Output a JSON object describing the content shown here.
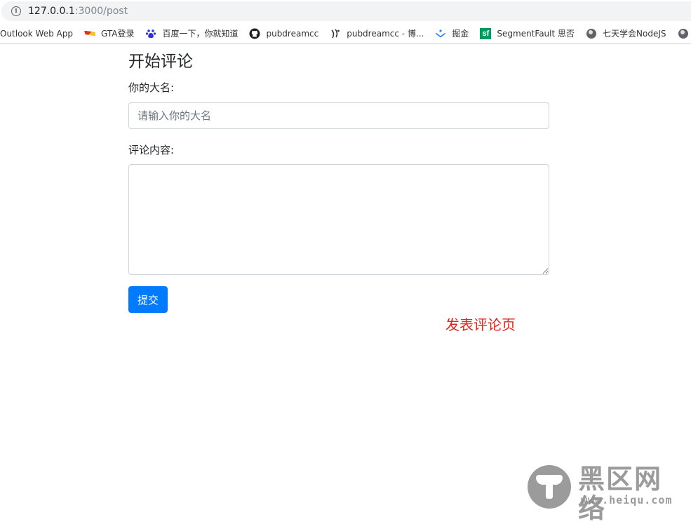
{
  "browser": {
    "url_host": "127.0.0.1",
    "url_path": ":3000/post",
    "bookmarks": [
      {
        "label": "Outlook Web App",
        "icon": "none"
      },
      {
        "label": "GTA登录",
        "icon": "gta-icon"
      },
      {
        "label": "百度一下，你就知道",
        "icon": "baidu-paw-icon"
      },
      {
        "label": "pubdreamcc",
        "icon": "github-icon"
      },
      {
        "label": "pubdreamcc - 博...",
        "icon": "cnblogs-icon"
      },
      {
        "label": "掘金",
        "icon": "juejin-icon"
      },
      {
        "label": "SegmentFault 思否",
        "icon": "segmentfault-icon"
      },
      {
        "label": "七天学会NodeJS",
        "icon": "globe-icon"
      },
      {
        "label": "",
        "icon": "globe-icon"
      }
    ],
    "sf_glyph": "sf",
    "info_glyph": "i"
  },
  "form": {
    "title": "开始评论",
    "name_label": "你的大名:",
    "name_placeholder": "请输入你的大名",
    "content_label": "评论内容:",
    "submit_label": "提交"
  },
  "annotation": "发表评论页",
  "watermark": {
    "text": "黑区网络",
    "url": "www.heiqu.com"
  },
  "colors": {
    "primary": "#007bff",
    "annotation": "#e2231a",
    "sf_green": "#009a61"
  }
}
